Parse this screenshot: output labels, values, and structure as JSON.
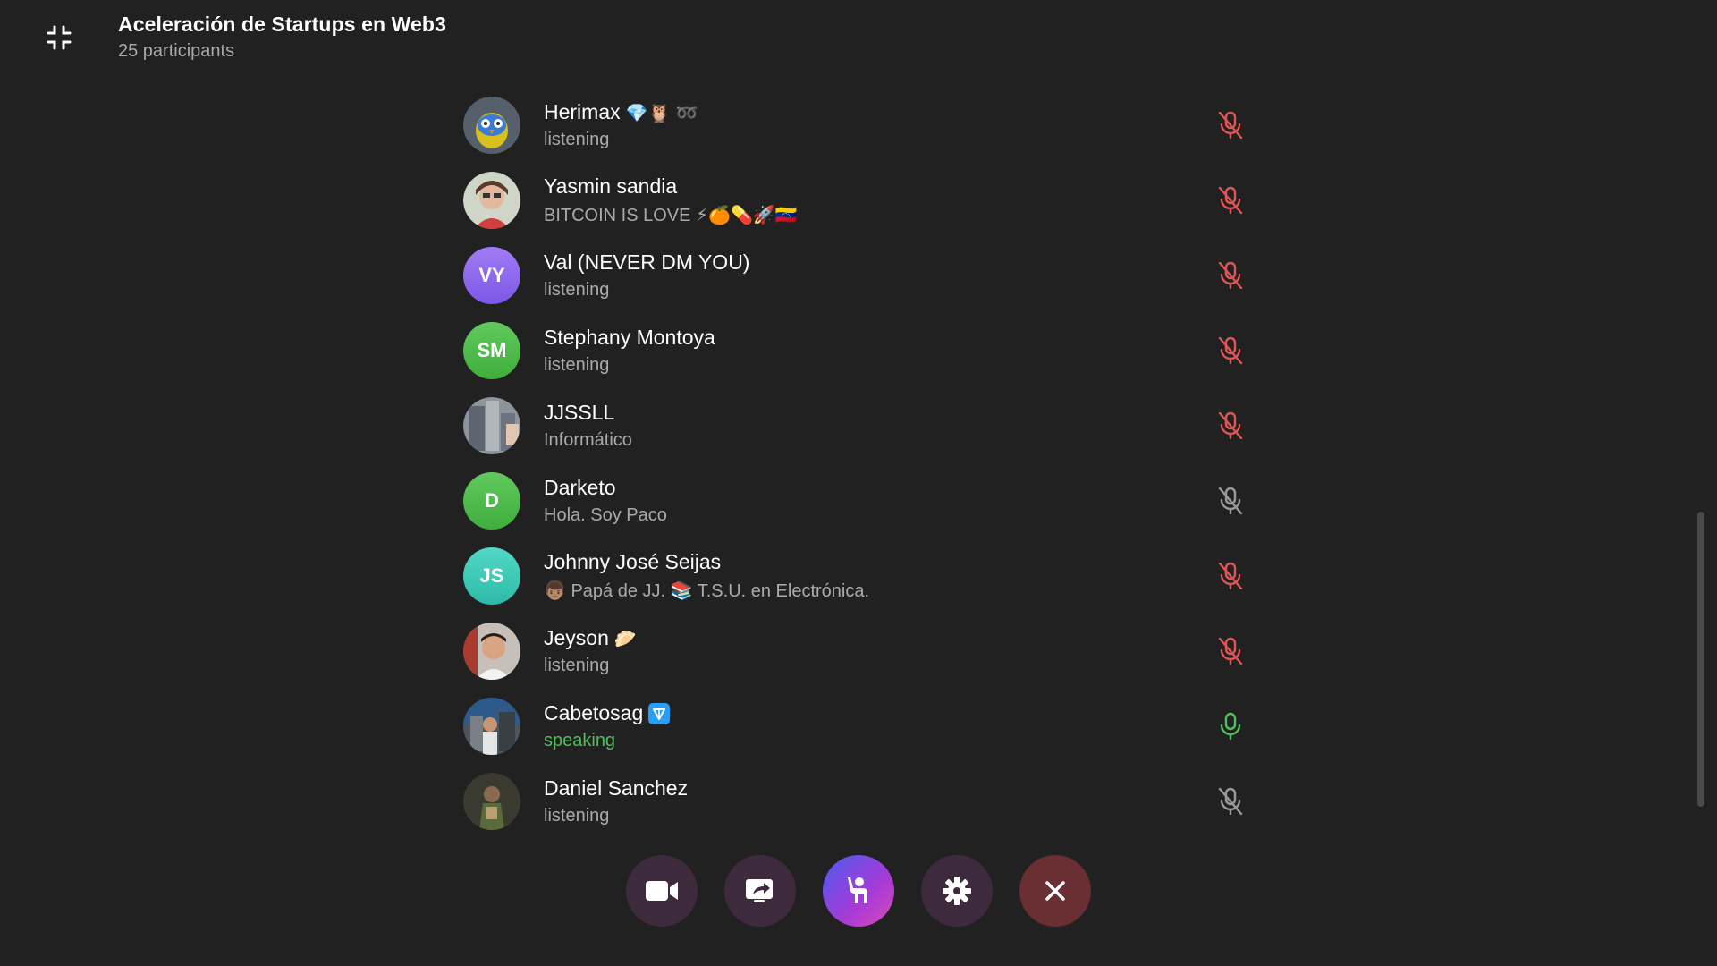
{
  "header": {
    "title": "Aceleración de Startups en Web3",
    "subtitle": "25 participants"
  },
  "colors": {
    "background": "#212121",
    "muted_mic": "#e05555",
    "unmuted_gray": "#9a9a9a",
    "speaking": "#4fbf5a"
  },
  "participants": [
    {
      "name": "Herimax",
      "name_suffix": "💎🦉 ➿",
      "status": "listening",
      "avatar": "owl-avatar",
      "mic": "muted-red"
    },
    {
      "name": "Yasmin sandia",
      "name_suffix": "",
      "status": "BITCOIN IS LOVE ⚡🍊💊🚀🇻🇪",
      "avatar": "photo-avatar",
      "mic": "muted-red"
    },
    {
      "name": "Val (NEVER DM YOU)",
      "name_suffix": "",
      "status": "listening",
      "avatar_initials": "VY",
      "avatar_color": "#8f6cf0",
      "mic": "muted-red"
    },
    {
      "name": "Stephany Montoya",
      "name_suffix": "",
      "status": "listening",
      "avatar_initials": "SM",
      "avatar_color": "#4cb84a",
      "mic": "muted-red"
    },
    {
      "name": "JJSSLL",
      "name_suffix": "",
      "status": "Informático",
      "avatar": "photo-avatar",
      "mic": "muted-red"
    },
    {
      "name": "Darketo",
      "name_suffix": "",
      "status": "Hola. Soy Paco",
      "avatar_initials": "D",
      "avatar_color": "#4cb84a",
      "mic": "muted-gray"
    },
    {
      "name": "Johnny José Seijas",
      "name_suffix": "",
      "status": "👦🏽 Papá de JJ. 📚 T.S.U. en Electrónica.",
      "avatar_initials": "JS",
      "avatar_color": "#3cc9b8",
      "mic": "muted-red"
    },
    {
      "name": "Jeyson",
      "name_suffix": "🥟",
      "status": "listening",
      "avatar": "photo-avatar",
      "mic": "muted-red"
    },
    {
      "name": "Cabetosag",
      "name_suffix": "",
      "status": "speaking",
      "avatar": "photo-avatar",
      "mic": "active-green"
    },
    {
      "name": "Daniel Sanchez",
      "name_suffix": "",
      "status": "listening",
      "avatar": "photo-avatar",
      "mic": "muted-gray"
    }
  ],
  "controls": [
    {
      "name": "video-button",
      "icon": "video-camera-icon"
    },
    {
      "name": "share-screen-button",
      "icon": "screen-share-icon"
    },
    {
      "name": "raise-hand-button",
      "icon": "raise-hand-icon"
    },
    {
      "name": "settings-button",
      "icon": "gear-icon"
    },
    {
      "name": "leave-button",
      "icon": "close-icon"
    }
  ]
}
